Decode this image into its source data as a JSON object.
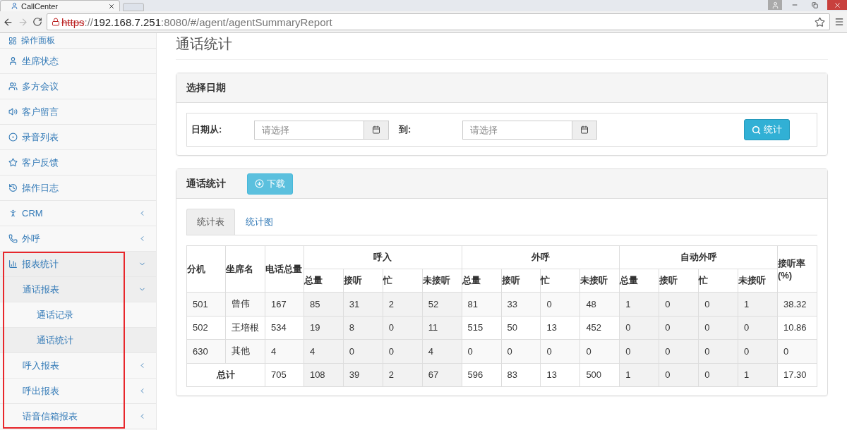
{
  "browser": {
    "tab_title": "CallCenter",
    "url": {
      "scheme": "https",
      "separator": "://",
      "host": "192.168.7.251",
      "rest": ":8080/#/agent/agentSummaryReport"
    }
  },
  "sidebar": {
    "items": [
      {
        "label": "操作面板"
      },
      {
        "label": "坐席状态"
      },
      {
        "label": "多方会议"
      },
      {
        "label": "客户留言"
      },
      {
        "label": "录音列表"
      },
      {
        "label": "客户反馈"
      },
      {
        "label": "操作日志"
      },
      {
        "label": "CRM",
        "expanded": false
      },
      {
        "label": "外呼",
        "expanded": false
      },
      {
        "label": "报表统计",
        "expanded": true,
        "children": [
          {
            "label": "通话报表",
            "expanded": true,
            "children": [
              {
                "label": "通话记录",
                "selected": false
              },
              {
                "label": "通话统计",
                "selected": true
              }
            ]
          },
          {
            "label": "呼入报表",
            "expanded": false
          },
          {
            "label": "呼出报表",
            "expanded": false
          },
          {
            "label": "语音信箱报表",
            "expanded": false
          }
        ]
      }
    ]
  },
  "page_title": "通话统计",
  "date_panel": {
    "title": "选择日期",
    "from_label": "日期从:",
    "from_placeholder": "请选择",
    "to_label": "到:",
    "to_placeholder": "请选择",
    "submit_button": "统计"
  },
  "stats_panel": {
    "title": "通话统计",
    "download_button": "下载",
    "tabs": [
      {
        "label": "统计表",
        "selected": true
      },
      {
        "label": "统计图",
        "selected": false
      }
    ],
    "table": {
      "fixed_columns": [
        "分机",
        "坐席名",
        "电话总量"
      ],
      "groups": [
        {
          "label": "呼入",
          "columns": [
            "总量",
            "接听",
            "忙",
            "未接听"
          ]
        },
        {
          "label": "外呼",
          "columns": [
            "总量",
            "接听",
            "忙",
            "未接听"
          ]
        },
        {
          "label": "自动外呼",
          "columns": [
            "总量",
            "接听",
            "忙",
            "未接听"
          ]
        }
      ],
      "rate_column": "接听率(%)",
      "rows": [
        {
          "ext": "501",
          "agent": "曾伟",
          "total": "167",
          "values": [
            "85",
            "31",
            "2",
            "52",
            "81",
            "33",
            "0",
            "48",
            "1",
            "0",
            "0",
            "1"
          ],
          "rate": "38.32"
        },
        {
          "ext": "502",
          "agent": "王培根",
          "total": "534",
          "values": [
            "19",
            "8",
            "0",
            "11",
            "515",
            "50",
            "13",
            "452",
            "0",
            "0",
            "0",
            "0"
          ],
          "rate": "10.86"
        },
        {
          "ext": "630",
          "agent": "其他",
          "total": "4",
          "values": [
            "4",
            "0",
            "0",
            "4",
            "0",
            "0",
            "0",
            "0",
            "0",
            "0",
            "0",
            "0"
          ],
          "rate": "0"
        }
      ],
      "total_row": {
        "label": "总计",
        "total": "705",
        "values": [
          "108",
          "39",
          "2",
          "67",
          "596",
          "83",
          "13",
          "500",
          "1",
          "0",
          "0",
          "1"
        ],
        "rate": "17.30"
      }
    }
  }
}
